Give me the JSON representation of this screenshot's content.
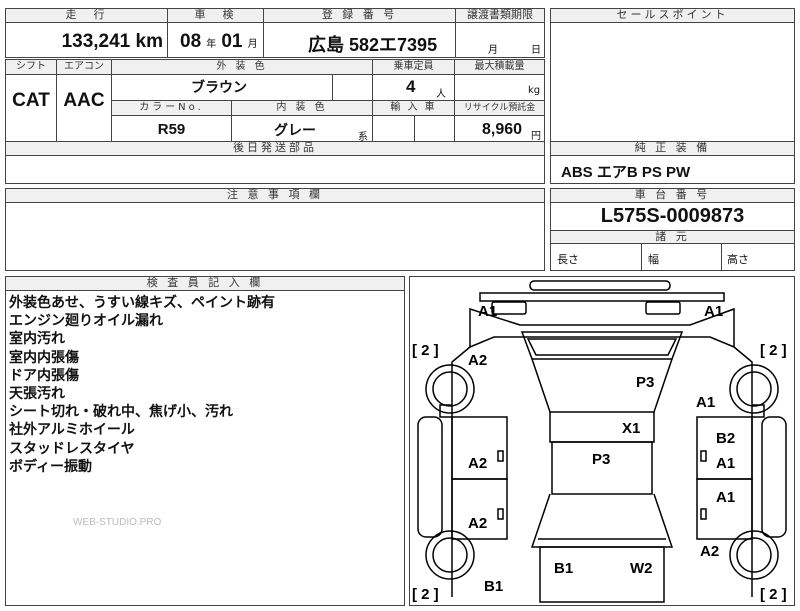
{
  "top": {
    "mileage_label": "走　行",
    "mileage_value": "133,241",
    "mileage_unit": "km",
    "inspection_label": "車　検",
    "inspection_year": "08",
    "inspection_year_unit": "年",
    "inspection_month": "01",
    "inspection_month_unit": "月",
    "registration_label": "登 録 番 号",
    "registration_value": "広島 582エ7395",
    "transfer_label": "譲渡書類期限",
    "transfer_month_unit": "月",
    "transfer_day_unit": "日",
    "selling_points_label": "セールスポイント"
  },
  "specs": {
    "shift_label": "シフト",
    "shift_value": "CAT",
    "ac_label": "エアコン",
    "ac_value": "AAC",
    "exterior_color_label": "外 装 色",
    "exterior_color_value": "ブラウン",
    "capacity_label": "乗車定員",
    "capacity_value": "4",
    "capacity_unit": "人",
    "max_load_label": "最大積載量",
    "max_load_unit": "kg",
    "color_no_label": "カラーNo.",
    "color_no_value": "R59",
    "interior_color_label": "内 装 色",
    "interior_color_value": "グレー",
    "interior_color_unit": "系",
    "import_label": "輸 入 車",
    "recycle_label": "リサイクル預託金",
    "recycle_value": "8,960",
    "recycle_unit": "円",
    "parts_label": "後日発送部品"
  },
  "equipment": {
    "label": "純 正 装 備",
    "value": "ABS エアB PS PW"
  },
  "caution": {
    "label": "注 意 事 項 欄"
  },
  "chassis": {
    "label": "車 台 番 号",
    "value": "L575S-0009873",
    "dimensions_label": "諸 元",
    "length_label": "長さ",
    "width_label": "幅",
    "height_label": "高さ"
  },
  "inspector": {
    "label": "検 査 員 記 入 欄",
    "notes": [
      "外装色あせ、うすい線キズ、ペイント跡有",
      "エンジン廻りオイル漏れ",
      "室内汚れ",
      "室内内張傷",
      "ドア内張傷",
      "天張汚れ",
      "シート切れ・破れ中、焦げ小、汚れ",
      "社外アルミホイール",
      "スタッドレスタイヤ",
      "ボディー振動"
    ],
    "watermark": "WEB-STUDIO.PRO"
  },
  "diagram": {
    "marks": [
      "A1",
      "A1",
      "A2",
      "P3",
      "A1",
      "X1",
      "B2",
      "A2",
      "P3",
      "A1",
      "A1",
      "A2",
      "A2",
      "B1",
      "W2",
      "B1"
    ],
    "tires": [
      "[ 2 ]",
      "[ 2 ]",
      "[ 2 ]",
      "[ 2 ]"
    ]
  }
}
